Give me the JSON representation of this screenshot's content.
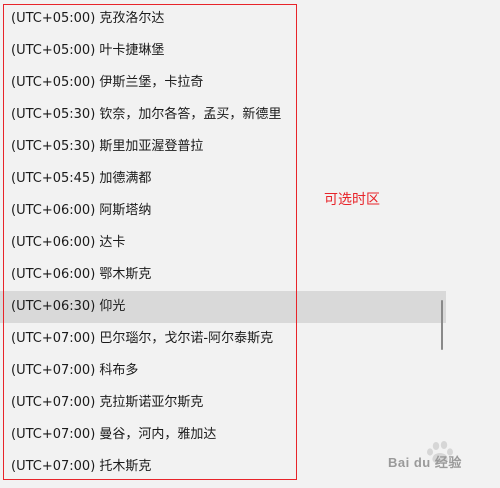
{
  "timezone_list": {
    "items": [
      {
        "label": "(UTC+05:00) 克孜洛尔达"
      },
      {
        "label": "(UTC+05:00) 叶卡捷琳堡"
      },
      {
        "label": "(UTC+05:00) 伊斯兰堡，卡拉奇"
      },
      {
        "label": "(UTC+05:30) 钦奈，加尔各答，孟买，新德里"
      },
      {
        "label": "(UTC+05:30) 斯里加亚渥登普拉"
      },
      {
        "label": "(UTC+05:45) 加德满都"
      },
      {
        "label": "(UTC+06:00) 阿斯塔纳"
      },
      {
        "label": "(UTC+06:00) 达卡"
      },
      {
        "label": "(UTC+06:00) 鄂木斯克"
      },
      {
        "label": "(UTC+06:30) 仰光",
        "selected": true
      },
      {
        "label": "(UTC+07:00) 巴尔瑙尔，戈尔诺-阿尔泰斯克"
      },
      {
        "label": "(UTC+07:00) 科布多"
      },
      {
        "label": "(UTC+07:00) 克拉斯诺亚尔斯克"
      },
      {
        "label": "(UTC+07:00) 曼谷，河内，雅加达"
      },
      {
        "label": "(UTC+07:00) 托木斯克"
      }
    ]
  },
  "annotation": {
    "label": "可选时区",
    "color": "#e8242a"
  },
  "watermark": {
    "text": "Bai du 经验"
  },
  "colors": {
    "background": "#f2f2f2",
    "selected_row": "#d9d9d9",
    "text": "#1a1a1a"
  }
}
